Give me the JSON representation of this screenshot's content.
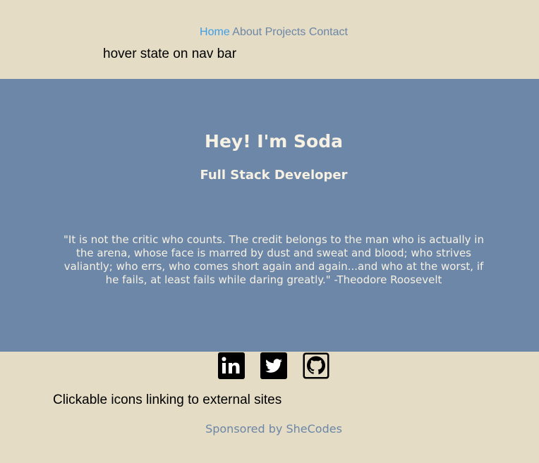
{
  "nav": {
    "items": [
      {
        "label": "Home",
        "active": true
      },
      {
        "label": "About"
      },
      {
        "label": "Projects"
      },
      {
        "label": "Contact"
      }
    ]
  },
  "annotations": {
    "nav_note": "hover state on nav bar",
    "icons_note": "Clickable icons linking to external sites"
  },
  "hero": {
    "title": "Hey! I'm Soda",
    "subtitle": "Full Stack Developer",
    "quote": "\"It is not the critic who counts. The credit belongs to the man who is actually in the arena, whose face is marred by dust and sweat and blood; who strives valiantly; who errs, who comes short again and again...and who at the worst, if he fails, at least fails while daring greatly.\" -Theodore Roosevelt"
  },
  "social": {
    "icons": [
      "linkedin-icon",
      "twitter-icon",
      "github-icon"
    ]
  },
  "footer": {
    "prefix": "Sponsored by ",
    "link": "SheCodes"
  },
  "colors": {
    "background": "#e4dcc4",
    "hero": "#6d87a8",
    "nav_link": "#6c86a8",
    "nav_active": "#3f9ee8",
    "hero_text": "#f6f1e3"
  }
}
